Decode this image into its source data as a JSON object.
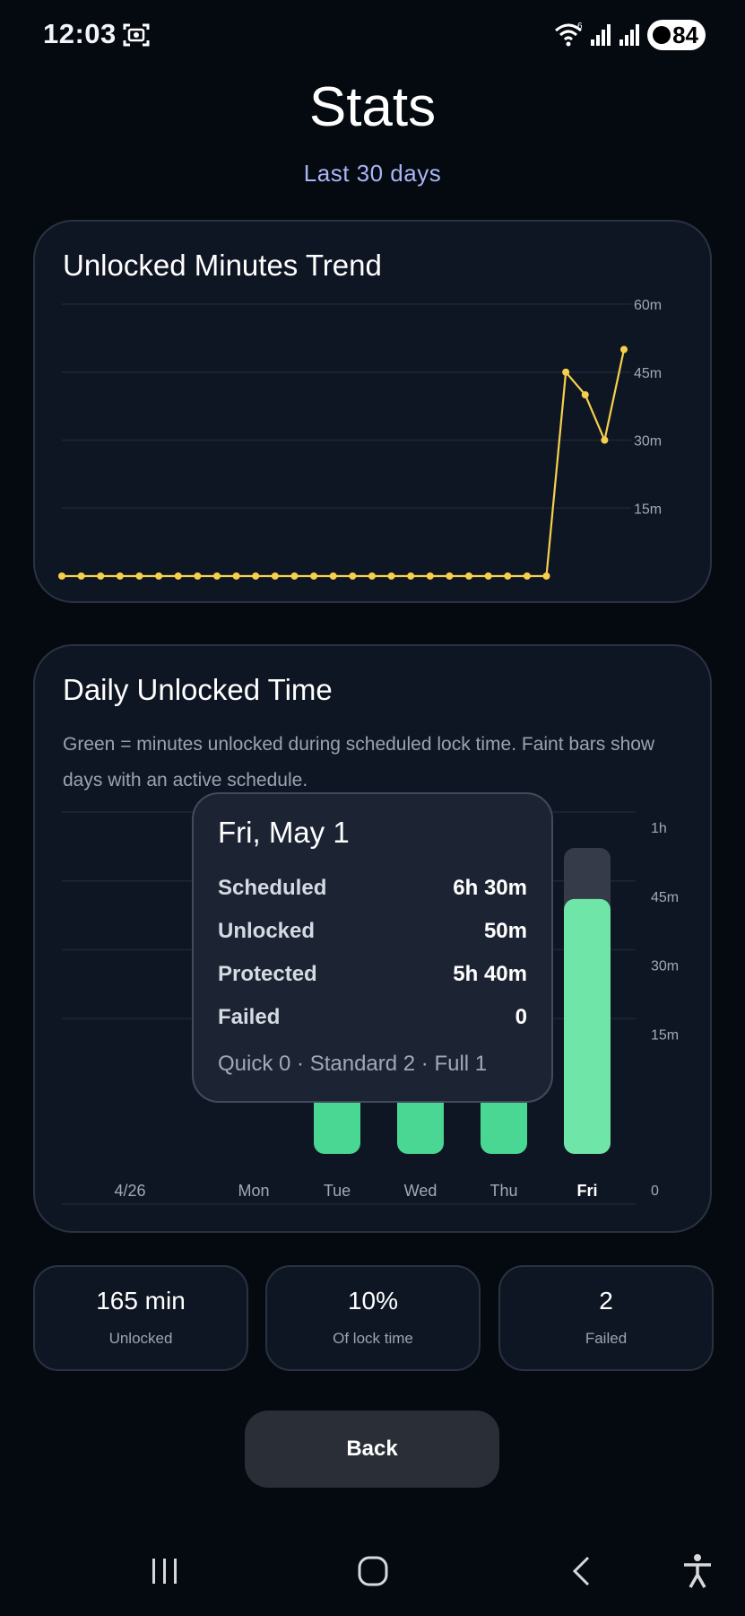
{
  "status": {
    "time": "12:03",
    "battery": "84"
  },
  "header": {
    "title": "Stats",
    "subtitle": "Last 30 days"
  },
  "trend_card": {
    "title": "Unlocked Minutes Trend"
  },
  "daily_card": {
    "title": "Daily Unlocked Time",
    "description": "Green = minutes unlocked during scheduled lock time. Faint bars show days with an active schedule."
  },
  "tooltip": {
    "title": "Fri, May 1",
    "rows": [
      {
        "label": "Scheduled",
        "value": "6h 30m"
      },
      {
        "label": "Unlocked",
        "value": "50m"
      },
      {
        "label": "Protected",
        "value": "5h 40m"
      },
      {
        "label": "Failed",
        "value": "0"
      }
    ],
    "footer": "Quick 0 · Standard 2 · Full 1"
  },
  "summary": [
    {
      "value": "165 min",
      "label": "Unlocked"
    },
    {
      "value": "10%",
      "label": "Of lock time"
    },
    {
      "value": "2",
      "label": "Failed"
    }
  ],
  "back_label": "Back",
  "colors": {
    "line": "#f6d04d",
    "bar": "#4ad693",
    "bar_active": "#6fe5a8",
    "schedule_bar": "#353b48",
    "accent_sub": "#a9b5f5"
  },
  "chart_data": [
    {
      "type": "line",
      "title": "Unlocked Minutes Trend",
      "y_ticks": [
        "60m",
        "45m",
        "30m",
        "15m"
      ],
      "ylim": [
        0,
        60
      ],
      "unit": "minutes",
      "values": [
        0,
        0,
        0,
        0,
        0,
        0,
        0,
        0,
        0,
        0,
        0,
        0,
        0,
        0,
        0,
        0,
        0,
        0,
        0,
        0,
        0,
        0,
        0,
        0,
        0,
        0,
        45,
        40,
        30,
        50
      ]
    },
    {
      "type": "bar",
      "title": "Daily Unlocked Time",
      "y_ticks": [
        "1h",
        "45m",
        "30m",
        "15m",
        "0"
      ],
      "ylim": [
        0,
        60
      ],
      "unit": "minutes",
      "categories": [
        "4/26",
        "Mon",
        "Tue",
        "Wed",
        "Thu",
        "Fri"
      ],
      "values": [
        0,
        0,
        45,
        40,
        30,
        50
      ],
      "schedule_values": [
        0,
        0,
        0,
        0,
        0,
        60
      ],
      "active_category": "Fri"
    }
  ]
}
